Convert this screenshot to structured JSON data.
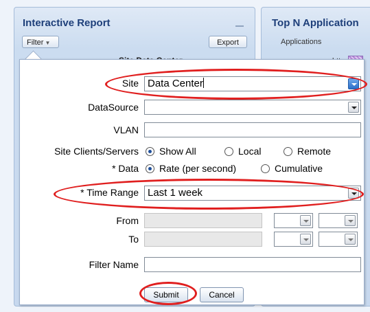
{
  "left_panel": {
    "title": "Interactive Report",
    "filter_label": "Filter",
    "export_label": "Export",
    "site_header": "Site  Data Center"
  },
  "right_panel": {
    "title": "Top N Application",
    "subtitle": "Applications",
    "legend_item": "http"
  },
  "form": {
    "site": {
      "label": "Site",
      "value": "Data Center"
    },
    "datasource": {
      "label": "DataSource",
      "value": ""
    },
    "vlan": {
      "label": "VLAN",
      "value": ""
    },
    "clients_servers": {
      "label": "Site Clients/Servers",
      "options": [
        "Show All",
        "Local",
        "Remote"
      ],
      "selected": "Show All"
    },
    "data": {
      "label": "* Data",
      "options": [
        "Rate (per second)",
        "Cumulative"
      ],
      "selected": "Rate (per second)"
    },
    "time_range": {
      "label": "* Time Range",
      "value": "Last 1 week"
    },
    "from": {
      "label": "From"
    },
    "to": {
      "label": "To"
    },
    "filter_name": {
      "label": "Filter Name",
      "value": ""
    },
    "submit_label": "Submit",
    "cancel_label": "Cancel"
  },
  "colors": {
    "highlight": "#e01f1f",
    "title": "#1e3f7a",
    "panel": "#cbdcf0"
  },
  "icons": [
    "dropdown-arrow-icon",
    "minimize-icon",
    "caret-down-icon"
  ]
}
